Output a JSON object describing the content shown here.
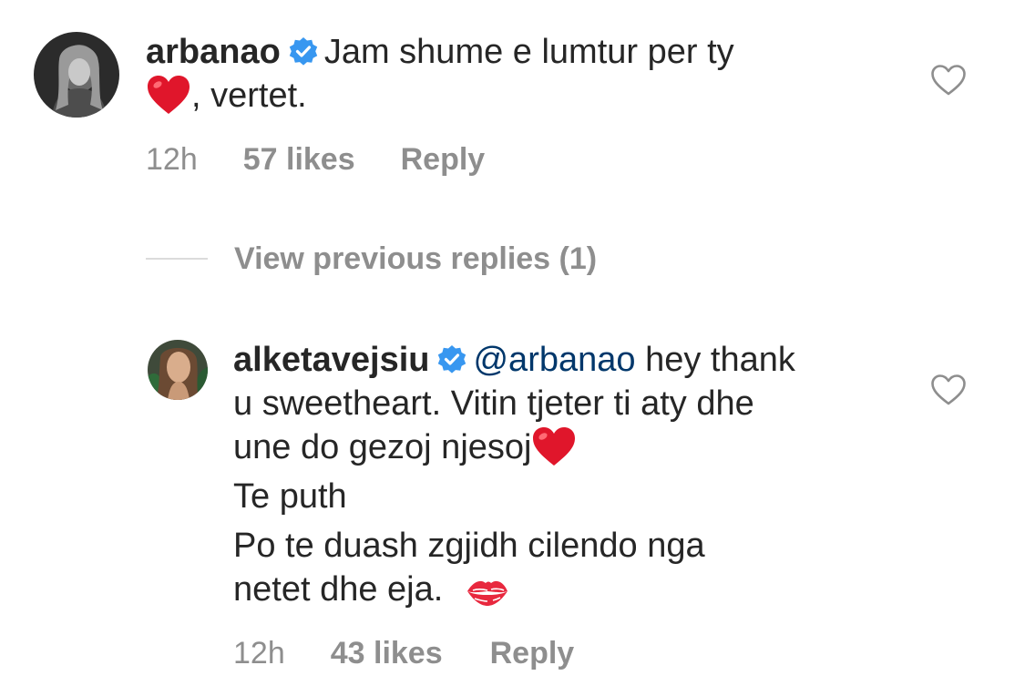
{
  "comments": [
    {
      "username": "arbanao",
      "verified": true,
      "text_line1": "Jam shume e lumtur per ty",
      "text_line2": ", vertet.",
      "emoji": "red-heart",
      "time": "12h",
      "likes": "57 likes",
      "reply_label": "Reply"
    },
    {
      "username": "alketavejsiu",
      "verified": true,
      "mention": "@arbanao",
      "text_line1": "hey thank",
      "text_line2": "u sweetheart. Vitin tjeter ti aty dhe",
      "text_line3": "une do gezoj njesoj",
      "text_line4": "Te puth",
      "text_line5": "Po te duash zgjidh cilendo nga",
      "text_line6": "netet  dhe eja.",
      "emojis": [
        "red-heart",
        "kiss-mark"
      ],
      "time": "12h",
      "likes": "43 likes",
      "reply_label": "Reply"
    }
  ],
  "view_previous_replies": "View previous replies (1)",
  "colors": {
    "text": "#262626",
    "secondary": "#8e8e8e",
    "mention": "#00376b",
    "verified": "#3897f0",
    "divider": "#dbdbdb",
    "heart": "#e0162b"
  },
  "icons": {
    "like": "heart-outline-icon",
    "verified": "verified-badge-icon"
  }
}
